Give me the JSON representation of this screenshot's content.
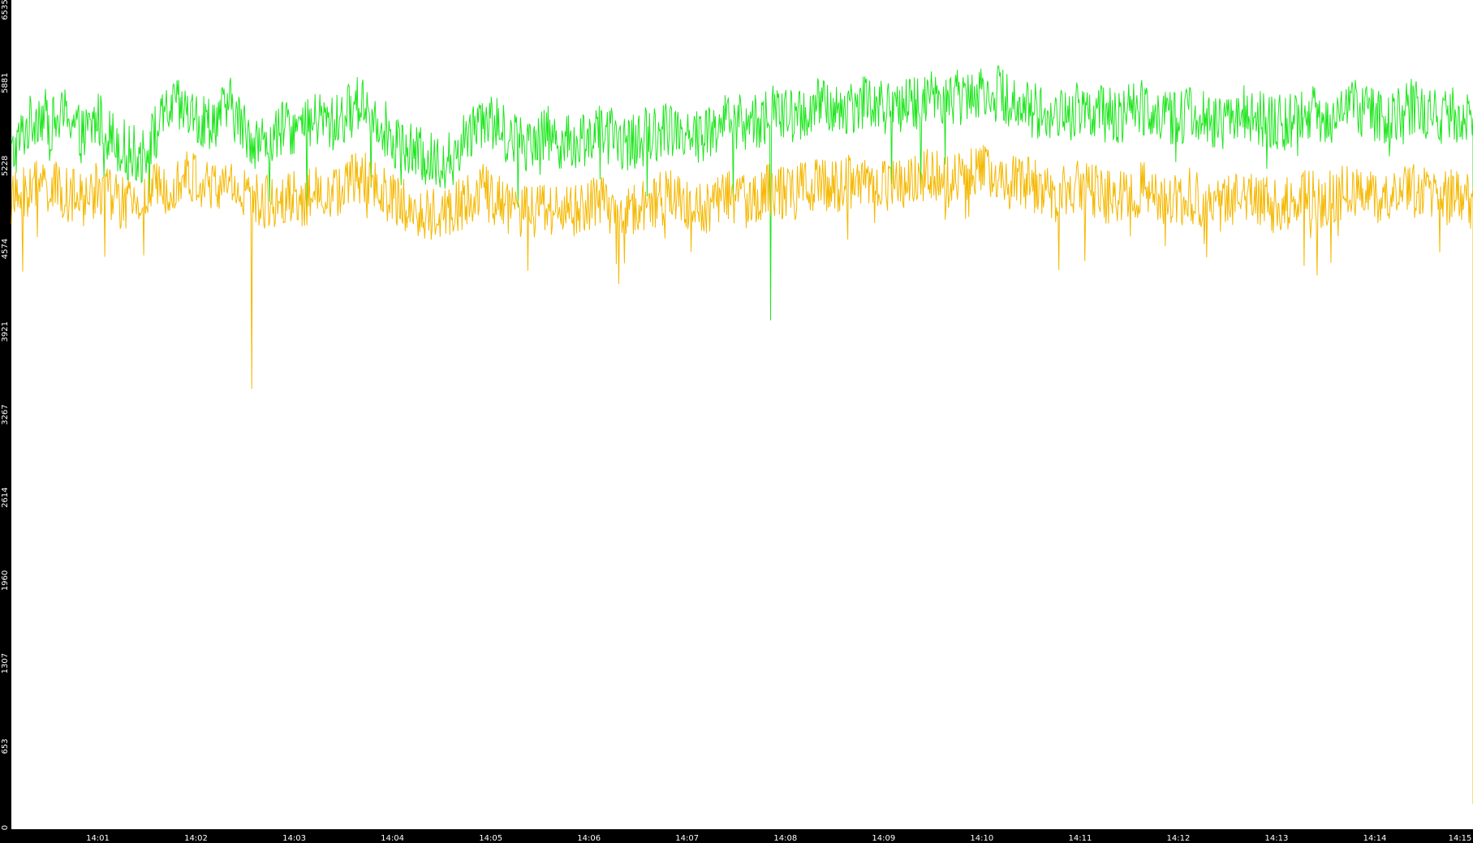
{
  "colors": {
    "background": "#000000",
    "plot_background": "#ffffff",
    "tick_text": "#ffffff",
    "series_green": "#1ee61e",
    "series_orange": "#f5b800"
  },
  "chart_data": {
    "type": "line",
    "title": "",
    "xlabel": "",
    "ylabel": "",
    "grid": false,
    "ylim": [
      0,
      6535
    ],
    "y_ticks": [
      "0",
      "653",
      "1307",
      "1960",
      "2614",
      "3267",
      "3921",
      "4574",
      "5228",
      "5881",
      "6535"
    ],
    "x_ticks": [
      "14:01",
      "14:02",
      "14:03",
      "14:04",
      "14:05",
      "14:06",
      "14:07",
      "14:08",
      "14:09",
      "14:10",
      "14:11",
      "14:12",
      "14:13",
      "14:14",
      "14:15"
    ],
    "x_start_minutes": -0.88,
    "x_end_minutes": 14.0,
    "series": [
      {
        "color": "#1ee61e",
        "values": [
          [
            -0.88,
            5300
          ],
          [
            -0.75,
            5500
          ],
          [
            -0.6,
            5650
          ],
          [
            -0.45,
            5550
          ],
          [
            -0.3,
            5650
          ],
          [
            -0.15,
            5450
          ],
          [
            0.0,
            5600
          ],
          [
            0.15,
            5450
          ],
          [
            0.3,
            5350
          ],
          [
            0.45,
            5300
          ],
          [
            0.6,
            5500
          ],
          [
            0.75,
            5700
          ],
          [
            0.9,
            5650
          ],
          [
            1.05,
            5550
          ],
          [
            1.2,
            5600
          ],
          [
            1.35,
            5700
          ],
          [
            1.5,
            5500
          ],
          [
            1.65,
            5400
          ],
          [
            1.8,
            5450
          ],
          [
            1.95,
            5550
          ],
          [
            2.1,
            5500
          ],
          [
            2.25,
            5600
          ],
          [
            2.4,
            5550
          ],
          [
            2.55,
            5650
          ],
          [
            2.7,
            5750
          ],
          [
            2.85,
            5600
          ],
          [
            3.0,
            5450
          ],
          [
            3.15,
            5350
          ],
          [
            3.3,
            5300
          ],
          [
            3.45,
            5250
          ],
          [
            3.6,
            5300
          ],
          [
            3.75,
            5450
          ],
          [
            3.9,
            5650
          ],
          [
            4.05,
            5550
          ],
          [
            4.2,
            5450
          ],
          [
            4.35,
            5400
          ],
          [
            4.5,
            5500
          ],
          [
            4.65,
            5450
          ],
          [
            4.8,
            5400
          ],
          [
            4.95,
            5450
          ],
          [
            5.1,
            5500
          ],
          [
            5.25,
            5450
          ],
          [
            5.4,
            5400
          ],
          [
            5.55,
            5450
          ],
          [
            5.7,
            5500
          ],
          [
            5.85,
            5550
          ],
          [
            6.0,
            5500
          ],
          [
            6.15,
            5450
          ],
          [
            6.3,
            5550
          ],
          [
            6.45,
            5600
          ],
          [
            6.6,
            5550
          ],
          [
            6.75,
            5600
          ],
          [
            6.9,
            5650
          ],
          [
            7.05,
            5600
          ],
          [
            7.2,
            5650
          ],
          [
            7.35,
            5700
          ],
          [
            7.5,
            5650
          ],
          [
            7.65,
            5700
          ],
          [
            7.8,
            5750
          ],
          [
            7.95,
            5700
          ],
          [
            8.1,
            5650
          ],
          [
            8.25,
            5700
          ],
          [
            8.4,
            5750
          ],
          [
            8.55,
            5800
          ],
          [
            8.7,
            5750
          ],
          [
            8.85,
            5800
          ],
          [
            9.0,
            5850
          ],
          [
            9.15,
            5800
          ],
          [
            9.3,
            5750
          ],
          [
            9.45,
            5700
          ],
          [
            9.6,
            5650
          ],
          [
            9.75,
            5600
          ],
          [
            9.9,
            5650
          ],
          [
            10.05,
            5700
          ],
          [
            10.2,
            5650
          ],
          [
            10.35,
            5600
          ],
          [
            10.5,
            5650
          ],
          [
            10.65,
            5700
          ],
          [
            10.8,
            5650
          ],
          [
            10.95,
            5600
          ],
          [
            11.1,
            5650
          ],
          [
            11.25,
            5600
          ],
          [
            11.4,
            5550
          ],
          [
            11.55,
            5600
          ],
          [
            11.7,
            5650
          ],
          [
            11.85,
            5600
          ],
          [
            12.0,
            5550
          ],
          [
            12.15,
            5600
          ],
          [
            12.3,
            5650
          ],
          [
            12.45,
            5600
          ],
          [
            12.6,
            5650
          ],
          [
            12.75,
            5700
          ],
          [
            12.9,
            5650
          ],
          [
            13.05,
            5600
          ],
          [
            13.2,
            5650
          ],
          [
            13.35,
            5700
          ],
          [
            13.5,
            5650
          ],
          [
            13.65,
            5600
          ],
          [
            13.8,
            5650
          ],
          [
            13.95,
            5600
          ],
          [
            14.0,
            5600
          ]
        ],
        "noise_amplitude": 230,
        "min_spike": [
          6.85,
          4010
        ]
      },
      {
        "color": "#f5b800",
        "values": [
          [
            -0.88,
            4950
          ],
          [
            -0.75,
            5000
          ],
          [
            -0.6,
            5100
          ],
          [
            -0.45,
            5050
          ],
          [
            -0.3,
            5000
          ],
          [
            -0.15,
            4950
          ],
          [
            0.0,
            5050
          ],
          [
            0.15,
            5000
          ],
          [
            0.3,
            4900
          ],
          [
            0.45,
            4950
          ],
          [
            0.6,
            5050
          ],
          [
            0.75,
            5100
          ],
          [
            0.9,
            5150
          ],
          [
            1.05,
            5100
          ],
          [
            1.2,
            5050
          ],
          [
            1.35,
            5100
          ],
          [
            1.5,
            5000
          ],
          [
            1.65,
            4950
          ],
          [
            1.8,
            4950
          ],
          [
            1.95,
            5000
          ],
          [
            2.1,
            4950
          ],
          [
            2.25,
            5050
          ],
          [
            2.4,
            5000
          ],
          [
            2.55,
            5100
          ],
          [
            2.7,
            5150
          ],
          [
            2.85,
            5050
          ],
          [
            3.0,
            4950
          ],
          [
            3.15,
            4900
          ],
          [
            3.3,
            4850
          ],
          [
            3.45,
            4850
          ],
          [
            3.6,
            4900
          ],
          [
            3.75,
            4950
          ],
          [
            3.9,
            5050
          ],
          [
            4.05,
            4950
          ],
          [
            4.2,
            4900
          ],
          [
            4.35,
            4850
          ],
          [
            4.5,
            4900
          ],
          [
            4.65,
            4900
          ],
          [
            4.8,
            4850
          ],
          [
            4.95,
            4900
          ],
          [
            5.1,
            4950
          ],
          [
            5.25,
            4900
          ],
          [
            5.4,
            4850
          ],
          [
            5.55,
            4900
          ],
          [
            5.7,
            4950
          ],
          [
            5.85,
            5000
          ],
          [
            6.0,
            4950
          ],
          [
            6.15,
            4900
          ],
          [
            6.3,
            4950
          ],
          [
            6.45,
            5000
          ],
          [
            6.6,
            4950
          ],
          [
            6.75,
            5000
          ],
          [
            6.9,
            5050
          ],
          [
            7.05,
            5000
          ],
          [
            7.2,
            5050
          ],
          [
            7.35,
            5100
          ],
          [
            7.5,
            5050
          ],
          [
            7.65,
            5100
          ],
          [
            7.8,
            5150
          ],
          [
            7.95,
            5100
          ],
          [
            8.1,
            5050
          ],
          [
            8.25,
            5100
          ],
          [
            8.4,
            5150
          ],
          [
            8.55,
            5150
          ],
          [
            8.7,
            5100
          ],
          [
            8.85,
            5150
          ],
          [
            9.0,
            5200
          ],
          [
            9.15,
            5150
          ],
          [
            9.3,
            5100
          ],
          [
            9.45,
            5100
          ],
          [
            9.6,
            5050
          ],
          [
            9.75,
            5000
          ],
          [
            9.9,
            5050
          ],
          [
            10.05,
            5050
          ],
          [
            10.2,
            5000
          ],
          [
            10.35,
            4950
          ],
          [
            10.5,
            5000
          ],
          [
            10.65,
            5050
          ],
          [
            10.8,
            5000
          ],
          [
            10.95,
            4950
          ],
          [
            11.1,
            5000
          ],
          [
            11.25,
            4950
          ],
          [
            11.4,
            4900
          ],
          [
            11.55,
            4950
          ],
          [
            11.7,
            5000
          ],
          [
            11.85,
            4950
          ],
          [
            12.0,
            4900
          ],
          [
            12.15,
            4950
          ],
          [
            12.3,
            5000
          ],
          [
            12.45,
            4950
          ],
          [
            12.6,
            5000
          ],
          [
            12.75,
            5050
          ],
          [
            12.9,
            5000
          ],
          [
            13.05,
            4950
          ],
          [
            13.2,
            5000
          ],
          [
            13.35,
            5050
          ],
          [
            13.5,
            5000
          ],
          [
            13.65,
            4950
          ],
          [
            13.8,
            5000
          ],
          [
            13.95,
            4950
          ],
          [
            14.0,
            4950
          ]
        ],
        "noise_amplitude": 220,
        "min_spike": [
          1.57,
          3470
        ]
      }
    ]
  }
}
